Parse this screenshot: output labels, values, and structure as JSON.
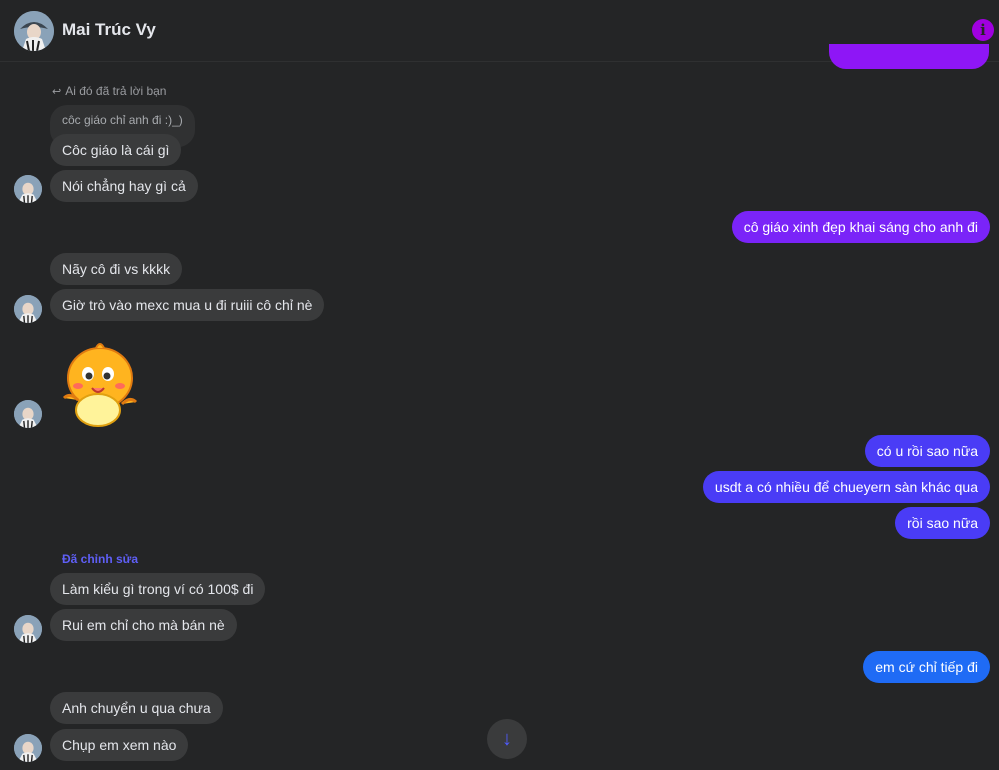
{
  "header": {
    "contact_name": "Mai Trúc Vy",
    "info_icon": "info-icon"
  },
  "reply": {
    "note": "Ai đó đã trả lời bạn",
    "quoted_text": "côc giáo chỉ anh đi :)_)"
  },
  "messages": {
    "m1": "Côc giáo là cái gì",
    "m2": "Nói chẳng hay gì cả",
    "m3": "cô giáo xinh đẹp khai sáng cho anh đi",
    "m4": "Nãy cô đi vs kkkk",
    "m5": "Giờ trò vào mexc mua u đi ruiii cô chỉ nè",
    "m6": "có u rồi sao nữa",
    "m7": "usdt a có nhiều để chueyern sàn khác qua",
    "m8": "rồi sao nữa",
    "edited_note": "Đã chỉnh sửa",
    "m9": "Làm kiểu gì trong ví có 100$ đi",
    "m10": "Rui em chỉ cho mà bán nè",
    "m11": "em cứ chỉ tiếp đi",
    "m12": "Anh chuyển u qua chưa",
    "m13": "Chụp em xem nào"
  },
  "colors": {
    "background": "#242526",
    "incoming_bubble": "#3a3b3c",
    "outgoing_purple": "#8e16f6",
    "outgoing_indigo": "#4a3cf6",
    "outgoing_blue": "#1f6bf5",
    "info_icon": "#a000e0"
  },
  "icons": {
    "sticker": "chick-sticker",
    "scroll_down": "arrow-down-icon"
  }
}
